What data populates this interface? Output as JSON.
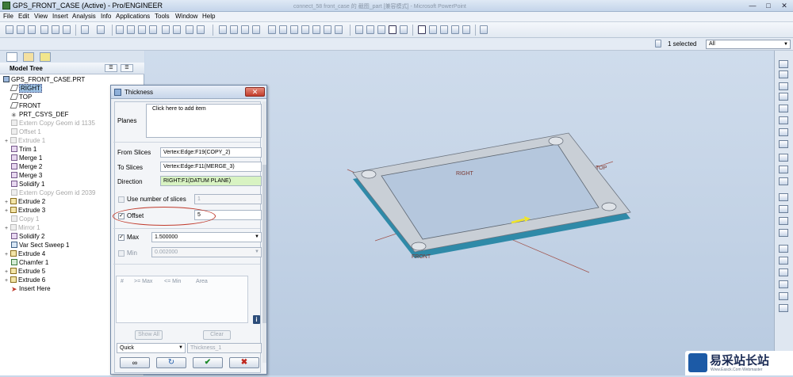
{
  "window": {
    "title": "GPS_FRONT_CASE (Active) - Pro/ENGINEER",
    "background_title": "connect_58 front_case 的 截图_part [兼容模式] - Microsoft PowerPoint"
  },
  "menu": [
    "File",
    "Edit",
    "View",
    "Insert",
    "Analysis",
    "Info",
    "Applications",
    "Tools",
    "Window",
    "Help"
  ],
  "selection": {
    "count_text": "1 selected",
    "filter_value": "All"
  },
  "model_tree": {
    "header": "Model Tree",
    "items": [
      {
        "label": "GPS_FRONT_CASE.PRT",
        "state": "normal",
        "icon": "part-icon"
      },
      {
        "label": "RIGHT",
        "state": "selected",
        "icon": "datum-plane-icon"
      },
      {
        "label": "TOP",
        "state": "normal",
        "icon": "datum-plane-icon"
      },
      {
        "label": "FRONT",
        "state": "normal",
        "icon": "datum-plane-icon"
      },
      {
        "label": "PRT_CSYS_DEF",
        "state": "normal",
        "icon": "csys-icon"
      },
      {
        "label": "Extern Copy Geom id 1135",
        "state": "suppressed",
        "icon": "copy-geom-icon"
      },
      {
        "label": "Offset 1",
        "state": "suppressed",
        "icon": "offset-icon"
      },
      {
        "label": "Extrude 1",
        "state": "suppressed",
        "icon": "extrude-icon"
      },
      {
        "label": "Trim 1",
        "state": "normal",
        "icon": "trim-icon"
      },
      {
        "label": "Merge 1",
        "state": "normal",
        "icon": "merge-icon"
      },
      {
        "label": "Merge 2",
        "state": "normal",
        "icon": "merge-icon"
      },
      {
        "label": "Merge 3",
        "state": "normal",
        "icon": "merge-icon"
      },
      {
        "label": "Solidify 1",
        "state": "normal",
        "icon": "solidify-icon"
      },
      {
        "label": "Extern Copy Geom id 2039",
        "state": "suppressed",
        "icon": "copy-geom-icon"
      },
      {
        "label": "Extrude 2",
        "state": "normal",
        "icon": "extrude-icon"
      },
      {
        "label": "Extrude 3",
        "state": "normal",
        "icon": "extrude-icon"
      },
      {
        "label": "Copy 1",
        "state": "suppressed",
        "icon": "copy-icon"
      },
      {
        "label": "Mirror 1",
        "state": "suppressed",
        "icon": "mirror-icon"
      },
      {
        "label": "Solidify 2",
        "state": "normal",
        "icon": "solidify-icon"
      },
      {
        "label": "Var Sect Sweep 1",
        "state": "normal",
        "icon": "sweep-icon"
      },
      {
        "label": "Extrude 4",
        "state": "normal",
        "icon": "extrude-icon"
      },
      {
        "label": "Chamfer 1",
        "state": "normal",
        "icon": "chamfer-icon"
      },
      {
        "label": "Extrude 5",
        "state": "normal",
        "icon": "extrude-icon"
      },
      {
        "label": "Extrude 6",
        "state": "normal",
        "icon": "extrude-icon"
      },
      {
        "label": "Insert Here",
        "state": "normal",
        "icon": "insert-here-icon"
      }
    ]
  },
  "dialog": {
    "title": "Thickness",
    "planes_label": "Planes",
    "planes_placeholder": "Click here to add item",
    "from_slices_label": "From Slices",
    "from_slices_value": "Vertex:Edge:F19(COPY_2)",
    "to_slices_label": "To Slices",
    "to_slices_value": "Vertex:Edge:F11(MERGE_3)",
    "direction_label": "Direction",
    "direction_value": "RIGHT:F1(DATUM PLANE)",
    "use_number_label": "Use number of slices",
    "use_number_value": "1",
    "offset_label": "Offset",
    "offset_value": "5",
    "max_label": "Max",
    "max_value": "1.500000",
    "min_label": "Min",
    "min_value": "0.002000",
    "grid_columns": [
      "#",
      ">= Max",
      "<= Min",
      "Area"
    ],
    "show_all": "Show All",
    "clear": "Clear",
    "mode_value": "Quick",
    "name_value": "Thickness_1"
  },
  "viewport": {
    "datum_labels": [
      "RIGHT",
      "TOP",
      "FRONT"
    ]
  },
  "watermark": {
    "text": "易采站长站",
    "sub": "Www.Easck.Com Webmaster"
  },
  "colors": {
    "part_body": "#c9cfd6",
    "part_edge": "#2f8aa8",
    "selection_arrow": "#f0e52b",
    "highlight_ring": "#c0392b",
    "datum_line": "#a0524a"
  }
}
